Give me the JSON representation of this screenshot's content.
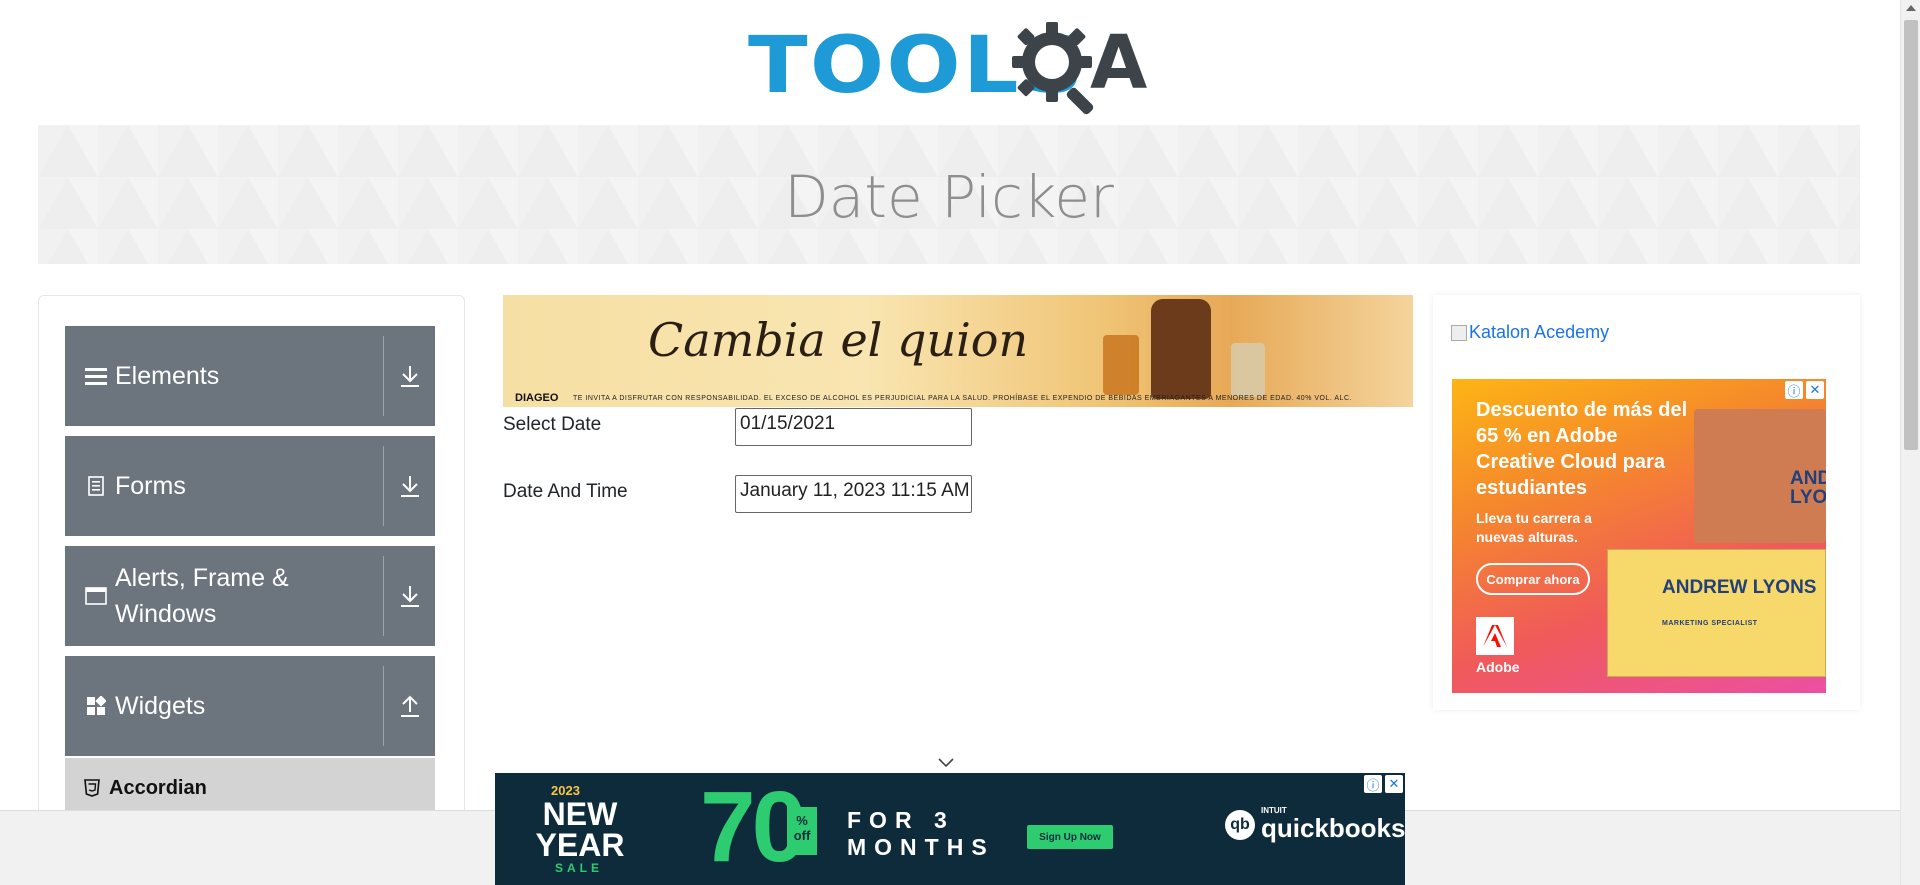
{
  "header": {
    "logo_text": "TOOLSQA",
    "logo_part_tools": "TOOLS",
    "logo_part_a": "A"
  },
  "banner": {
    "title": "Date Picker"
  },
  "sidebar": {
    "groups": [
      {
        "label": "Elements",
        "icon": "hamburger-icon",
        "arrow": "download-arrow-icon"
      },
      {
        "label": "Forms",
        "icon": "document-icon",
        "arrow": "download-arrow-icon"
      },
      {
        "label": "Alerts, Frame & Windows",
        "icon": "window-icon",
        "arrow": "download-arrow-icon"
      },
      {
        "label": "Widgets",
        "icon": "widgets-icon",
        "arrow": "upload-arrow-icon"
      }
    ],
    "sub_items": [
      {
        "label": "Accordian",
        "icon": "html5-shield-icon"
      }
    ]
  },
  "ad_top": {
    "headline": "Cambia el quion",
    "brand": "DIAGEO",
    "fine_print": "TE INVITA A DISFRUTAR CON RESPONSABILIDAD. EL EXCESO DE ALCOHOL ES PERJUDICIAL PARA LA SALUD. PROHÍBASE EL EXPENDIO DE BEBIDAS EMBRIAGANTES A MENORES DE EDAD. 40% VOL. ALC."
  },
  "form": {
    "select_date_label": "Select Date",
    "select_date_value": "01/15/2021",
    "date_time_label": "Date And Time",
    "date_time_value": "January 11, 2023 11:15 AM"
  },
  "right_sidebar": {
    "katalon_alt": "Katalon Acedemy",
    "ad": {
      "headline": "Descuento de más del 65 % en Adobe Creative Cloud para estudiantes",
      "subline": "Lleva tu carrera a nuevas alturas.",
      "button": "Comprar ahora",
      "brand": "Adobe",
      "name": "ANDREW LYONS",
      "name_partial": "AND LYO",
      "role": "MARKETING SPECIALIST",
      "info_icon": "ⓘ",
      "close_icon": "✕"
    }
  },
  "ad_bottom": {
    "year": "2023",
    "new_year": "NEW YEAR",
    "sale": "SALE",
    "percent": "70",
    "pct_off": "% off",
    "offer": "FOR 3 MONTHS",
    "cta": "Sign Up Now",
    "brand_small": "INTUIT",
    "brand": "quickbooks",
    "brand_mark": "qb",
    "info_icon": "ⓘ",
    "close_icon": "✕"
  },
  "colors": {
    "brand_blue": "#1e9bd7",
    "menu_gray": "#6c757d",
    "sub_item_bg": "#d3d3d3",
    "banner_title": "#8e8e8e"
  }
}
